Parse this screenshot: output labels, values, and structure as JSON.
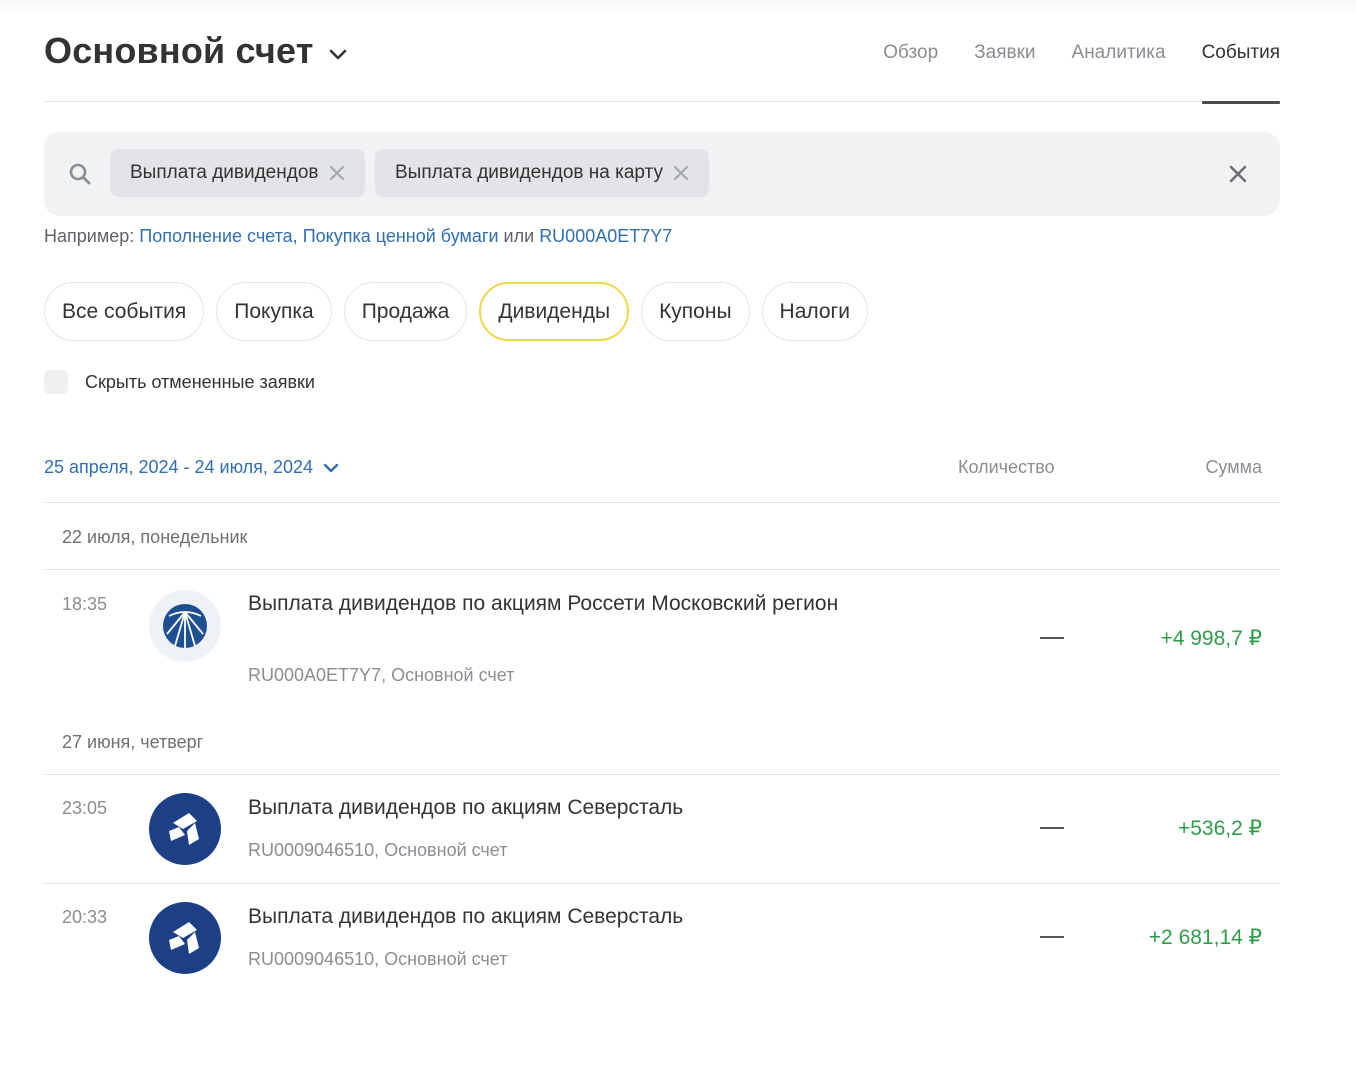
{
  "header": {
    "title": "Основной счет",
    "tabs": [
      {
        "label": "Обзор"
      },
      {
        "label": "Заявки"
      },
      {
        "label": "Аналитика"
      },
      {
        "label": "События",
        "active": true
      }
    ]
  },
  "search": {
    "chips": [
      {
        "label": "Выплата дивидендов"
      },
      {
        "label": "Выплата дивидендов на карту"
      }
    ]
  },
  "example": {
    "prefix": "Например:",
    "link1": "Пополнение счета,",
    "link2": "Покупка ценной бумаги",
    "connector": "или",
    "link3": "RU000A0ET7Y7"
  },
  "filters": [
    {
      "label": "Все события"
    },
    {
      "label": "Покупка"
    },
    {
      "label": "Продажа"
    },
    {
      "label": "Дивиденды",
      "active": true
    },
    {
      "label": "Купоны"
    },
    {
      "label": "Налоги"
    }
  ],
  "hide_cancelled": {
    "label": "Скрыть отмененные заявки",
    "checked": false
  },
  "list_header": {
    "date_range": "25 апреля, 2024 - 24 июля, 2024",
    "qty_label": "Количество",
    "sum_label": "Сумма"
  },
  "days": [
    {
      "label": "22 июля, понедельник",
      "events": [
        {
          "time": "18:35",
          "name": "Выплата дивидендов по акциям Россети Московский регион",
          "sub": "RU000A0ET7Y7, Основной счет",
          "qty": "—",
          "amount": "+4 998,7 ₽",
          "logo": "rosseti-logo"
        }
      ]
    },
    {
      "label": "27 июня, четверг",
      "events": [
        {
          "time": "23:05",
          "name": "Выплата дивидендов по акциям Северсталь",
          "sub": "RU0009046510, Основной счет",
          "qty": "—",
          "amount": "+536,2 ₽",
          "logo": "severstal-logo"
        },
        {
          "time": "20:33",
          "name": "Выплата дивидендов по акциям Северсталь",
          "sub": "RU0009046510, Основной счет",
          "qty": "—",
          "amount": "+2 681,14 ₽",
          "logo": "severstal-logo"
        }
      ]
    }
  ],
  "colors": {
    "accent_link": "#2f6fb0",
    "positive": "#2e9d4a",
    "active_filter_border": "#f0d84a",
    "severstal_blue": "#1c3f86",
    "rosseti_blue": "#1d4f91"
  }
}
